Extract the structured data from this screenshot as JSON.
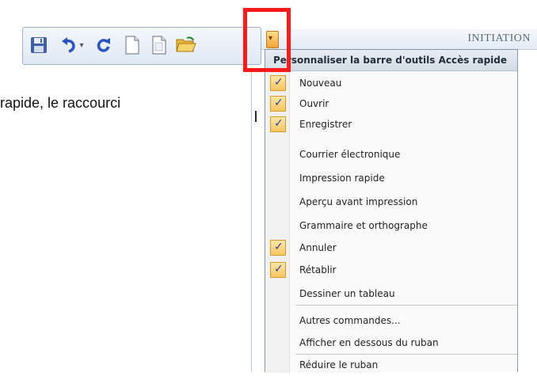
{
  "quick_access_toolbar": {
    "icons": [
      "save-icon",
      "undo-icon",
      "undo-dropdown-icon",
      "redo-icon",
      "new-document-icon",
      "new-page-icon",
      "open-folder-icon"
    ]
  },
  "document": {
    "text_fragment": "rapide, le raccourci"
  },
  "window": {
    "title": "INITIATION"
  },
  "menu": {
    "title": "Personnaliser la barre d'outils Accès rapide",
    "items": [
      {
        "label": "Nouveau",
        "checked": true
      },
      {
        "label": "Ouvrir",
        "checked": true
      },
      {
        "label": "Enregistrer",
        "checked": true
      },
      {
        "label": "Courrier électronique",
        "checked": false
      },
      {
        "label": "Impression rapide",
        "checked": false
      },
      {
        "label": "Aperçu avant impression",
        "checked": false
      },
      {
        "label": "Grammaire et orthographe",
        "checked": false
      },
      {
        "label": "Annuler",
        "checked": true
      },
      {
        "label": "Rétablir",
        "checked": true
      },
      {
        "label": "Dessiner un tableau",
        "checked": false
      },
      {
        "label": "Autres commandes...",
        "checked": false
      },
      {
        "label": "Afficher en dessous du ruban",
        "checked": false
      },
      {
        "label": "Réduire le ruban",
        "checked": false
      }
    ]
  },
  "colors": {
    "highlight_box": "#ff1a1a",
    "check_bg": "#f8c660",
    "check_mark": "#2a3f9e"
  }
}
